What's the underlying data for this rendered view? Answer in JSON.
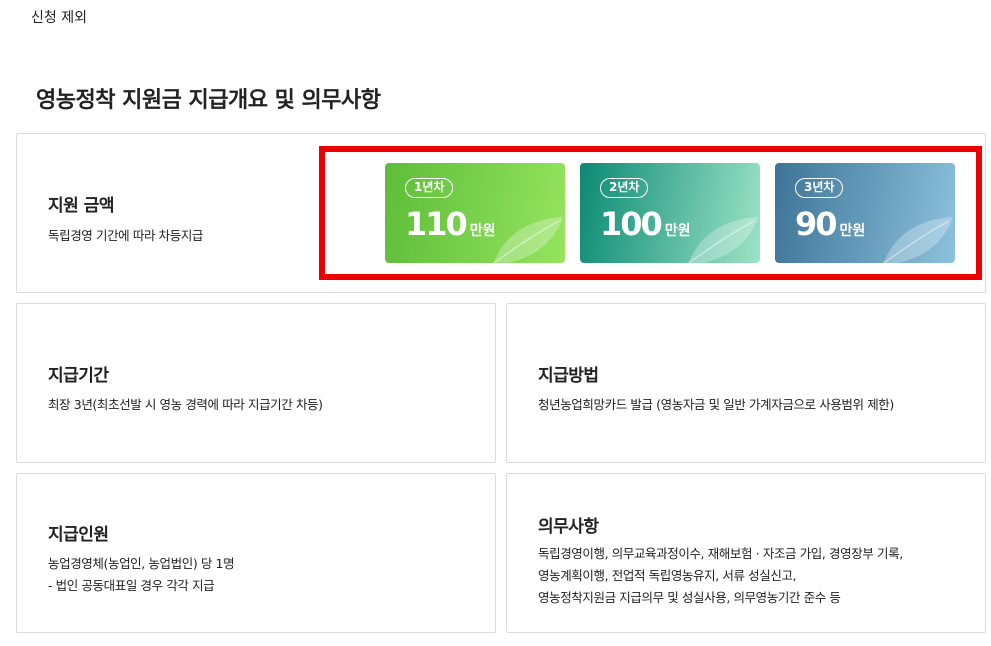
{
  "header": {
    "note": "신청 제외",
    "title": "영농정착 지원금 지급개요 및 의무사항"
  },
  "amount_card": {
    "title": "지원 금액",
    "desc": "독립경영 기간에 따라 차등지급",
    "tiers": [
      {
        "badge": "1년차",
        "amount": "110",
        "unit": "만원"
      },
      {
        "badge": "2년차",
        "amount": "100",
        "unit": "만원"
      },
      {
        "badge": "3년차",
        "amount": "90",
        "unit": "만원"
      }
    ],
    "highlight_color": "#ee0000"
  },
  "period_card": {
    "title": "지급기간",
    "desc": "최장 3년(최초선발 시 영농 경력에 따라 지급기간 차등)"
  },
  "method_card": {
    "title": "지급방법",
    "desc": "청년농업희망카드 발급 (영농자금 및 일반 가계자금으로 사용범위 제한)"
  },
  "recipient_card": {
    "title": "지급인원",
    "lines": [
      "농업경영체(농업인, 농업법인) 당 1명",
      "- 법인 공동대표일 경우 각각 지급"
    ]
  },
  "duty_card": {
    "title": "의무사항",
    "lines": [
      "독립경영이행, 의무교육과정이수, 재해보험 · 자조금 가입, 경영장부 기록,",
      "영농계획이행, 전업적 독립영농유지, 서류 성실신고,",
      "영농정착지원금 지급의무 및 성실사용, 의무영농기간 준수 등"
    ]
  },
  "icons": {
    "tier_decoration": "leaf-icon"
  }
}
